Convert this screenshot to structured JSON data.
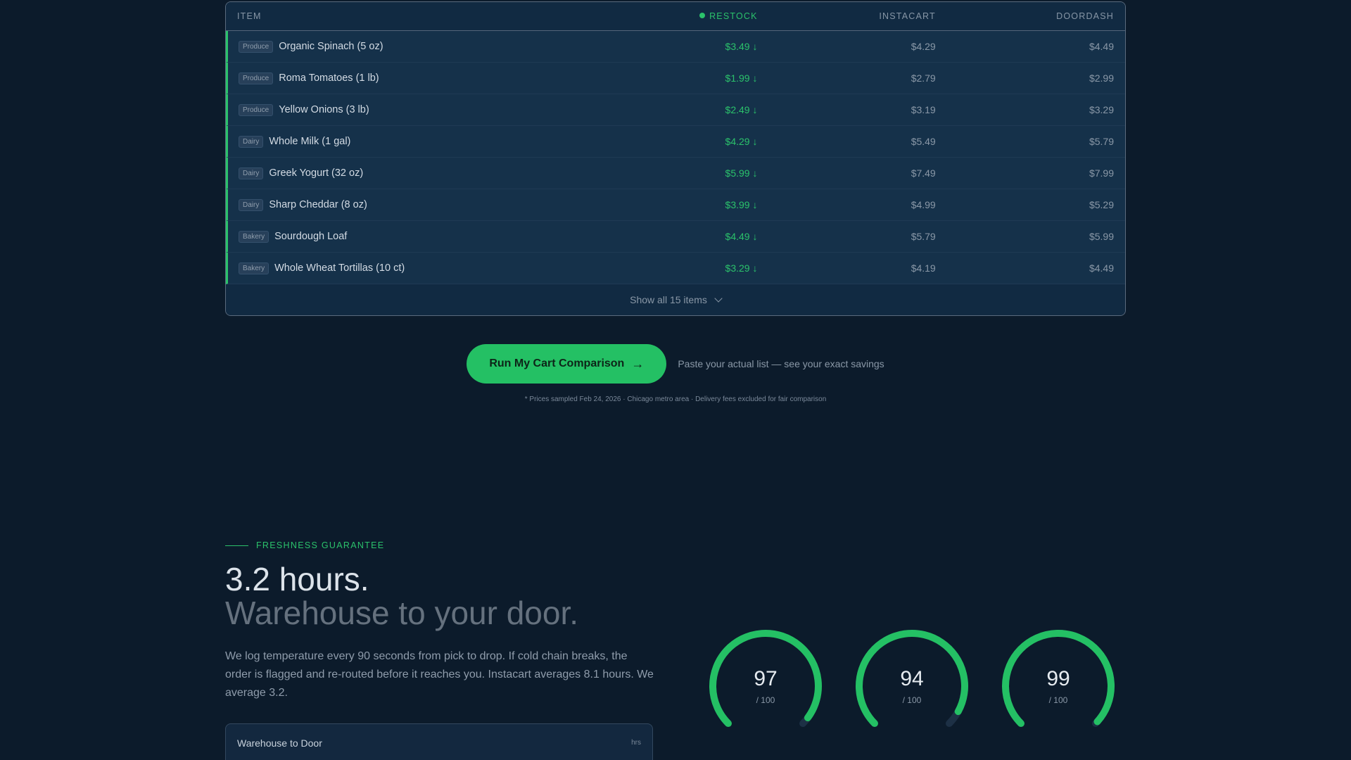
{
  "table": {
    "headers": {
      "item": "ITEM",
      "restock": "RESTOCK",
      "instacart": "INSTACART",
      "doordash": "DOORDASH"
    },
    "rows": [
      {
        "category": "Produce",
        "name": "Organic Spinach (5 oz)",
        "restock": "$3.49 ↓",
        "instacart": "$4.29",
        "doordash": "$4.49"
      },
      {
        "category": "Produce",
        "name": "Roma Tomatoes (1 lb)",
        "restock": "$1.99 ↓",
        "instacart": "$2.79",
        "doordash": "$2.99"
      },
      {
        "category": "Produce",
        "name": "Yellow Onions (3 lb)",
        "restock": "$2.49 ↓",
        "instacart": "$3.19",
        "doordash": "$3.29"
      },
      {
        "category": "Dairy",
        "name": "Whole Milk (1 gal)",
        "restock": "$4.29 ↓",
        "instacart": "$5.49",
        "doordash": "$5.79"
      },
      {
        "category": "Dairy",
        "name": "Greek Yogurt (32 oz)",
        "restock": "$5.99 ↓",
        "instacart": "$7.49",
        "doordash": "$7.99"
      },
      {
        "category": "Dairy",
        "name": "Sharp Cheddar (8 oz)",
        "restock": "$3.99 ↓",
        "instacart": "$4.99",
        "doordash": "$5.29"
      },
      {
        "category": "Bakery",
        "name": "Sourdough Loaf",
        "restock": "$4.49 ↓",
        "instacart": "$5.79",
        "doordash": "$5.99"
      },
      {
        "category": "Bakery",
        "name": "Whole Wheat Tortillas (10 ct)",
        "restock": "$3.29 ↓",
        "instacart": "$4.19",
        "doordash": "$4.49"
      }
    ],
    "show_all": "Show all 15 items"
  },
  "cta": {
    "button": "Run My Cart Comparison",
    "subtitle": "Paste your actual list — see your exact savings",
    "footnote": "* Prices sampled Feb 24, 2026 · Chicago metro area · Delivery fees excluded for fair comparison"
  },
  "freshness": {
    "eyebrow": "FRESHNESS GUARANTEE",
    "headline1": "3.2 hours.",
    "headline2": "Warehouse to your door.",
    "body": "We log temperature every 90 seconds from pick to drop. If cold chain breaks, the order is flagged and re-routed before it reaches you. Instacart averages 8.1 hours. We average 3.2.",
    "card_title": "Warehouse to Door",
    "card_unit": "hrs"
  },
  "gauges": [
    {
      "value": "97",
      "max_label": "/ 100",
      "score": 97
    },
    {
      "value": "94",
      "max_label": "/ 100",
      "score": 94
    },
    {
      "value": "99",
      "max_label": "/ 100",
      "score": 99
    }
  ],
  "colors": {
    "accent": "#24c064",
    "background": "#0c1b2b"
  }
}
